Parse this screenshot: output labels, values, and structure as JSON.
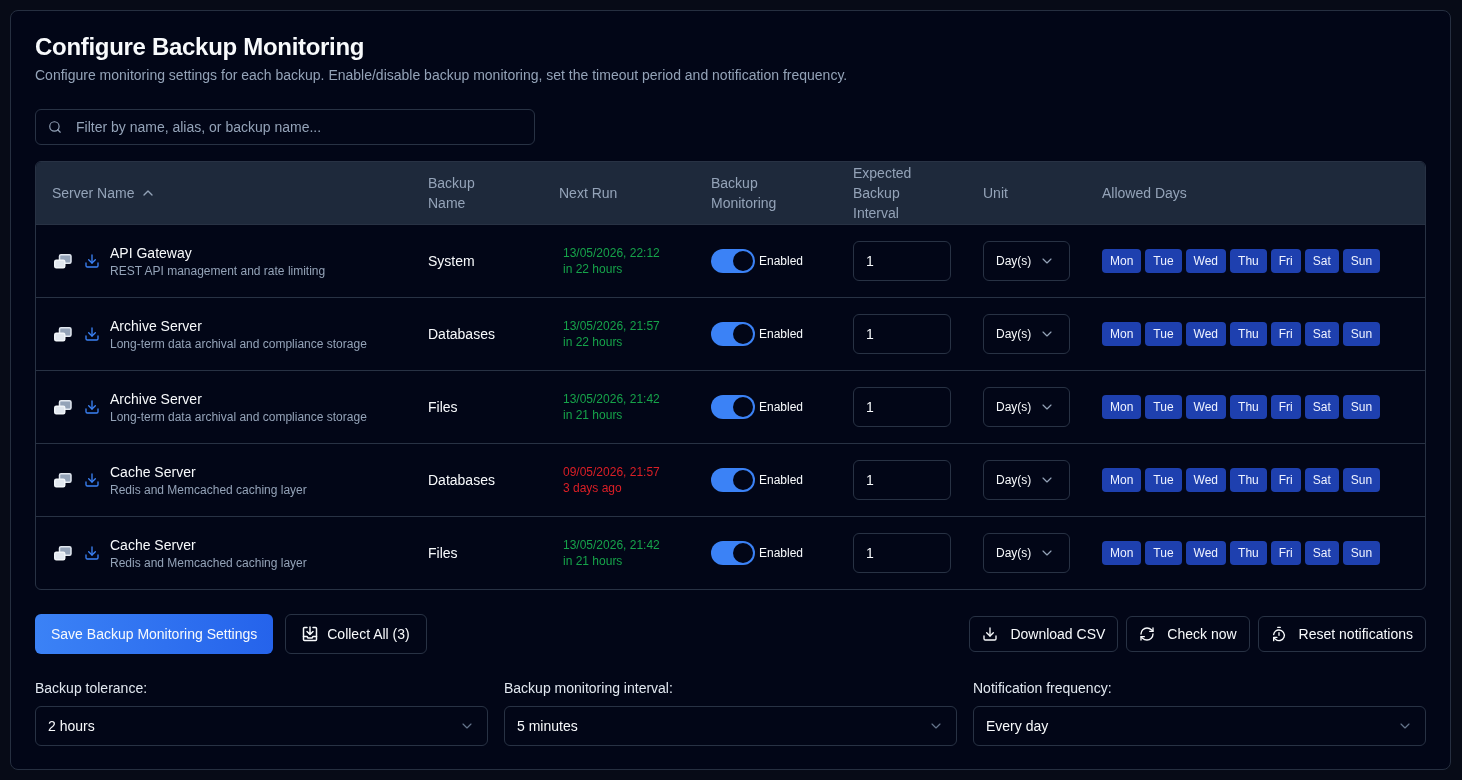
{
  "header": {
    "title": "Configure Backup Monitoring",
    "subtitle": "Configure monitoring settings for each backup. Enable/disable backup monitoring, set the timeout period and notification frequency."
  },
  "search": {
    "placeholder": "Filter by name, alias, or backup name..."
  },
  "table": {
    "columns": [
      {
        "label": "Server Name",
        "sorted": true,
        "ascending": true
      },
      {
        "label": "Backup Name",
        "sorted": false
      },
      {
        "label": "Next Run",
        "sorted": false
      },
      {
        "label": "Backup Monitoring",
        "sorted": false
      },
      {
        "label": "Expected Backup Interval",
        "sorted": false
      },
      {
        "label": "Unit",
        "sorted": false
      },
      {
        "label": "Allowed Days",
        "sorted": false
      }
    ],
    "rows": [
      {
        "server_name": "API Gateway",
        "description": "REST API management and rate limiting",
        "backup_name": "System",
        "next_run": {
          "date": "13/05/2026, 22:12",
          "relative": "in 22 hours",
          "overdue": false
        },
        "monitoring": {
          "on": true,
          "label": "Enabled"
        },
        "interval": "1",
        "unit": "Day(s)",
        "days": [
          {
            "label": "Mon",
            "selected": true
          },
          {
            "label": "Tue",
            "selected": true
          },
          {
            "label": "Wed",
            "selected": true
          },
          {
            "label": "Thu",
            "selected": true
          },
          {
            "label": "Fri",
            "selected": true
          },
          {
            "label": "Sat",
            "selected": true
          },
          {
            "label": "Sun",
            "selected": true
          }
        ]
      },
      {
        "server_name": "Archive Server",
        "description": "Long-term data archival and compliance storage",
        "backup_name": "Databases",
        "next_run": {
          "date": "13/05/2026, 21:57",
          "relative": "in 22 hours",
          "overdue": false
        },
        "monitoring": {
          "on": true,
          "label": "Enabled"
        },
        "interval": "1",
        "unit": "Day(s)",
        "days": [
          {
            "label": "Mon",
            "selected": true
          },
          {
            "label": "Tue",
            "selected": true
          },
          {
            "label": "Wed",
            "selected": true
          },
          {
            "label": "Thu",
            "selected": true
          },
          {
            "label": "Fri",
            "selected": true
          },
          {
            "label": "Sat",
            "selected": true
          },
          {
            "label": "Sun",
            "selected": true
          }
        ]
      },
      {
        "server_name": "Archive Server",
        "description": "Long-term data archival and compliance storage",
        "backup_name": "Files",
        "next_run": {
          "date": "13/05/2026, 21:42",
          "relative": "in 21 hours",
          "overdue": false
        },
        "monitoring": {
          "on": true,
          "label": "Enabled"
        },
        "interval": "1",
        "unit": "Day(s)",
        "days": [
          {
            "label": "Mon",
            "selected": true
          },
          {
            "label": "Tue",
            "selected": true
          },
          {
            "label": "Wed",
            "selected": true
          },
          {
            "label": "Thu",
            "selected": true
          },
          {
            "label": "Fri",
            "selected": true
          },
          {
            "label": "Sat",
            "selected": true
          },
          {
            "label": "Sun",
            "selected": true
          }
        ]
      },
      {
        "server_name": "Cache Server",
        "description": "Redis and Memcached caching layer",
        "backup_name": "Databases",
        "next_run": {
          "date": "09/05/2026, 21:57",
          "relative": "3 days ago",
          "overdue": true
        },
        "monitoring": {
          "on": true,
          "label": "Enabled"
        },
        "interval": "1",
        "unit": "Day(s)",
        "days": [
          {
            "label": "Mon",
            "selected": true
          },
          {
            "label": "Tue",
            "selected": true
          },
          {
            "label": "Wed",
            "selected": true
          },
          {
            "label": "Thu",
            "selected": true
          },
          {
            "label": "Fri",
            "selected": true
          },
          {
            "label": "Sat",
            "selected": true
          },
          {
            "label": "Sun",
            "selected": true
          }
        ]
      },
      {
        "server_name": "Cache Server",
        "description": "Redis and Memcached caching layer",
        "backup_name": "Files",
        "next_run": {
          "date": "13/05/2026, 21:42",
          "relative": "in 21 hours",
          "overdue": false
        },
        "monitoring": {
          "on": true,
          "label": "Enabled"
        },
        "interval": "1",
        "unit": "Day(s)",
        "days": [
          {
            "label": "Mon",
            "selected": true
          },
          {
            "label": "Tue",
            "selected": true
          },
          {
            "label": "Wed",
            "selected": true
          },
          {
            "label": "Thu",
            "selected": true
          },
          {
            "label": "Fri",
            "selected": true
          },
          {
            "label": "Sat",
            "selected": true
          },
          {
            "label": "Sun",
            "selected": true
          }
        ]
      }
    ]
  },
  "actions": {
    "left": [
      {
        "kind": "primary",
        "label": "Save Backup Monitoring Settings"
      },
      {
        "kind": "collect",
        "label": "Collect All (3)"
      }
    ],
    "right": [
      {
        "kind": "download",
        "label": "Download CSV"
      },
      {
        "kind": "refresh",
        "label": "Check now"
      },
      {
        "kind": "reset",
        "label": "Reset notifications"
      }
    ]
  },
  "settings": [
    {
      "label": "Backup tolerance:",
      "value": "2 hours"
    },
    {
      "label": "Backup monitoring interval:",
      "value": "5 minutes"
    },
    {
      "label": "Notification frequency:",
      "value": "Every day"
    }
  ]
}
